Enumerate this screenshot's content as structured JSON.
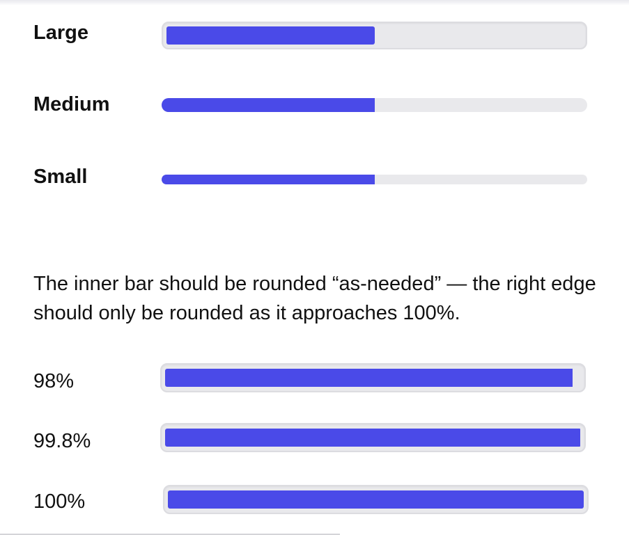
{
  "sizes": [
    {
      "label": "Large",
      "value": 50
    },
    {
      "label": "Medium",
      "value": 50
    },
    {
      "label": "Small",
      "value": 50
    }
  ],
  "note": "The inner bar should be rounded “as-needed” — the right edge should only be rounded as it approaches 100%.",
  "percents": [
    {
      "label": "98%",
      "value": 98
    },
    {
      "label": "99.8%",
      "value": 99.8
    },
    {
      "label": "100%",
      "value": 100
    }
  ],
  "colors": {
    "fill": "#4a4ae8",
    "track": "#e9e9ec"
  }
}
